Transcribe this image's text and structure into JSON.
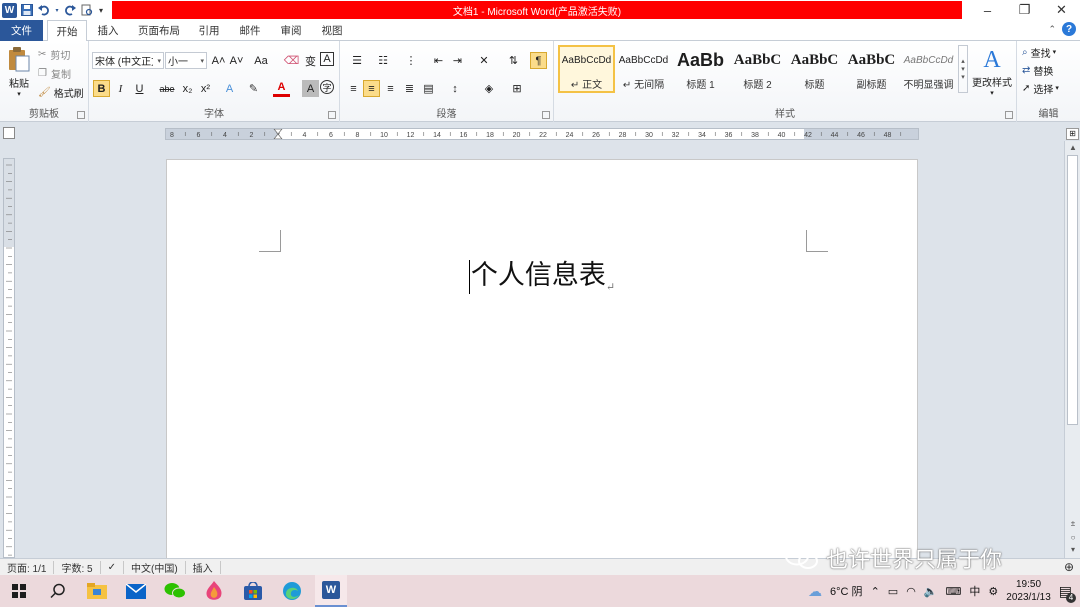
{
  "window": {
    "title": "文档1 - Microsoft Word(产品激活失败)",
    "app_icon": "W"
  },
  "colors": {
    "title_bar_bg": "#ff0000",
    "file_tab_bg": "#2b579a",
    "selected_style_border": "#f4c245"
  },
  "tabs": {
    "file": "文件",
    "home": "开始",
    "insert": "插入",
    "page_layout": "页面布局",
    "references": "引用",
    "mailings": "邮件",
    "review": "审阅",
    "view": "视图"
  },
  "clipboard": {
    "paste": "粘贴",
    "cut": "剪切",
    "copy": "复制",
    "format_painter": "格式刷",
    "label": "剪贴板"
  },
  "font": {
    "family": "宋体 (中文正文)",
    "size": "小一",
    "grow": "A˄",
    "shrink": "A˅",
    "change_case": "Aa",
    "bold": "B",
    "italic": "I",
    "underline": "U",
    "strike": "abe",
    "subscript": "x₂",
    "superscript": "x²",
    "label": "字体"
  },
  "paragraph": {
    "label": "段落"
  },
  "styles": {
    "items": [
      {
        "sample": "AaBbCcDd",
        "name": "↵ 正文"
      },
      {
        "sample": "AaBbCcDd",
        "name": "↵ 无间隔"
      },
      {
        "sample": "AaBb",
        "name": "标题 1"
      },
      {
        "sample": "AaBbC",
        "name": "标题 2"
      },
      {
        "sample": "AaBbC",
        "name": "标题"
      },
      {
        "sample": "AaBbC",
        "name": "副标题"
      },
      {
        "sample": "AaBbCcDd",
        "name": "不明显强调"
      }
    ],
    "change_styles": "更改样式",
    "label": "样式"
  },
  "editing": {
    "find": "查找",
    "replace": "替换",
    "select": "选择",
    "label": "编辑"
  },
  "ruler": {
    "labels": [
      "8",
      "6",
      "4",
      "2",
      "2",
      "4",
      "6",
      "8",
      "10",
      "12",
      "14",
      "16",
      "18",
      "20",
      "22",
      "24",
      "26",
      "28",
      "30",
      "32",
      "34",
      "36",
      "38",
      "40",
      "42",
      "44",
      "46",
      "48"
    ]
  },
  "document": {
    "title": "个人信息表",
    "paragraph_mark": "↵"
  },
  "statusbar": {
    "page": "页面: 1/1",
    "words": "字数: 5",
    "language": "中文(中国)",
    "mode": "插入"
  },
  "watermark": {
    "text": "也许世界只属于你"
  },
  "taskbar": {
    "weather": "6°C 阴",
    "ime": "中",
    "time": "19:50",
    "date": "2023/1/13",
    "notifications": "4"
  }
}
